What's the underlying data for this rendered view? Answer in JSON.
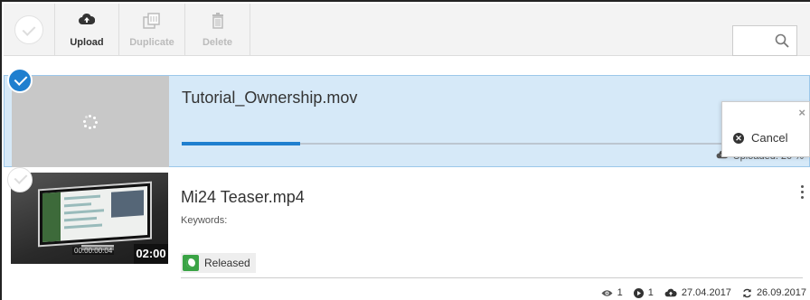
{
  "toolbar": {
    "buttons": [
      {
        "label": "Upload",
        "icon": "cloud-upload-icon",
        "enabled": true
      },
      {
        "label": "Duplicate",
        "icon": "duplicate-icon",
        "enabled": false
      },
      {
        "label": "Delete",
        "icon": "trash-icon",
        "enabled": false
      }
    ],
    "search": {
      "placeholder": "",
      "icon": "search-icon"
    }
  },
  "uploading_item": {
    "filename": "Tutorial_Ownership.mov",
    "selected": true,
    "progress_percent": 20,
    "status_text": "Uploaded: 20 %"
  },
  "context_menu": {
    "close_label": "×",
    "cancel_label": "Cancel"
  },
  "media_item": {
    "filename": "Mi24 Teaser.mp4",
    "selected": false,
    "keywords_label": "Keywords:",
    "duration": "02:00",
    "timecode": "00:00:00:04",
    "status_badge": "Released",
    "stats": {
      "views": "1",
      "plays": "1",
      "uploaded_date": "27.04.2017",
      "updated_date": "26.09.2017"
    }
  },
  "colors": {
    "accent": "#1f7fcf",
    "selected_row_bg": "#d6e9f8",
    "released_green": "#3aa345"
  }
}
